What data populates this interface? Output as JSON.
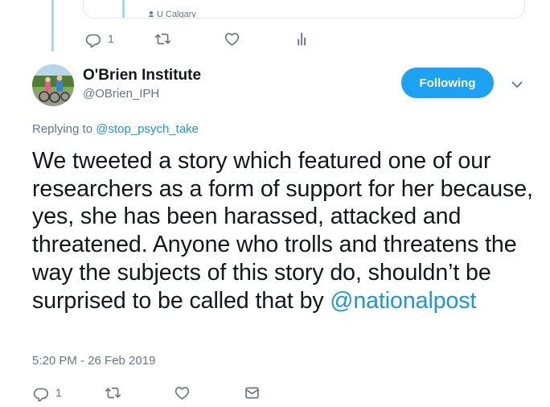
{
  "previous_tweet": {
    "card_source": "U Calgary",
    "actions": {
      "reply_count": "1",
      "retweet_count": "",
      "like_count": ""
    }
  },
  "tweet": {
    "author_name": "O'Brien Institute",
    "author_handle": "@OBrien_IPH",
    "follow_label": "Following",
    "replying_prefix": "Replying to",
    "replying_to": "@stop_psych_take",
    "text": "We tweeted a story which featured one of our researchers as a form of support for her because, yes, she has been harassed, attacked and threatened. Anyone who trolls and threatens the way the subjects of this story do, shouldn’t be surprised to be called that by ",
    "mention": "@nationalpost",
    "timestamp": "5:20 PM - 26 Feb 2019",
    "actions": {
      "reply_count": "1"
    }
  },
  "colors": {
    "accent": "#1da1f2",
    "link": "#1b95e0",
    "muted": "#657786",
    "thread_line": "#a9d4f2"
  },
  "icons": [
    "reply-icon",
    "retweet-icon",
    "like-icon",
    "analytics-icon",
    "direct-message-icon",
    "chevron-down-icon",
    "location-pin-icon"
  ]
}
